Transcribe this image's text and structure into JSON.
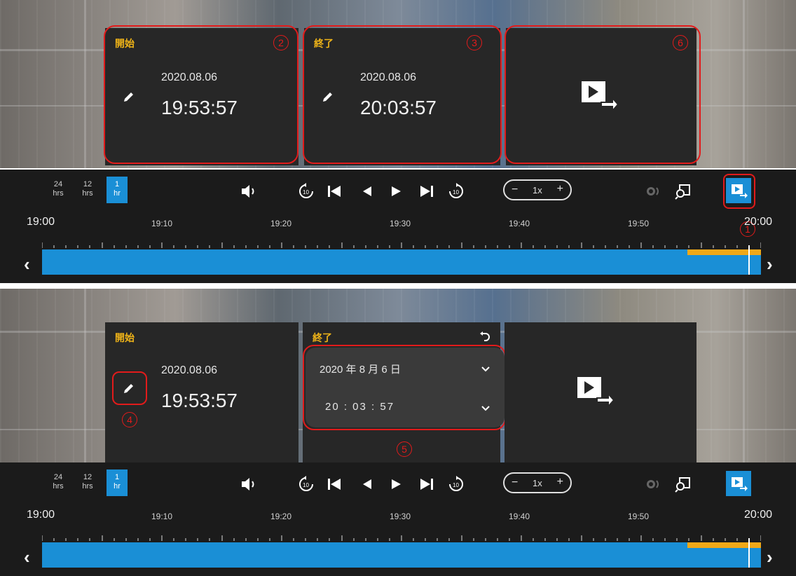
{
  "panels": [
    {
      "start": {
        "label": "開始",
        "date": "2020.08.06",
        "time": "19:53:57"
      },
      "end": {
        "label": "終了",
        "date": "2020.08.06",
        "time": "20:03:57"
      },
      "markers": {
        "start": "2",
        "end": "3",
        "export": "6",
        "export_small": "1"
      }
    },
    {
      "start": {
        "label": "開始",
        "date": "2020.08.06",
        "time": "19:53:57"
      },
      "end": {
        "label": "終了",
        "date_select": "2020 年 8 月 6 日",
        "time_select": "20 : 03 : 57"
      },
      "markers": {
        "edit": "4",
        "picker": "5"
      }
    }
  ],
  "toolbar": {
    "ranges": [
      {
        "top": "24",
        "bottom": "hrs",
        "active": false
      },
      {
        "top": "12",
        "bottom": "hrs",
        "active": false
      },
      {
        "top": "1",
        "bottom": "hr",
        "active": true
      }
    ],
    "speed": {
      "minus": "−",
      "value": "1x",
      "plus": "+"
    }
  },
  "timeline": {
    "ticks": [
      "19:00",
      "19:10",
      "19:20",
      "19:30",
      "19:40",
      "19:50",
      "20:00"
    ],
    "selection_start_fraction": 0.898,
    "playhead_fraction": 0.983
  },
  "icons": [
    "pencil-icon",
    "export-icon",
    "volume-icon",
    "replay-10-icon",
    "skip-start-icon",
    "step-back-icon",
    "play-icon",
    "skip-end-icon",
    "forward-10-icon",
    "eye-icon",
    "zoom-frame-icon",
    "chevron-left-icon",
    "chevron-right-icon",
    "undo-icon",
    "chevron-down-icon"
  ],
  "colors": {
    "accent": "#1a8fd6",
    "selection": "#f0a818",
    "annotation": "#e21b1b",
    "label": "#f0b418"
  }
}
